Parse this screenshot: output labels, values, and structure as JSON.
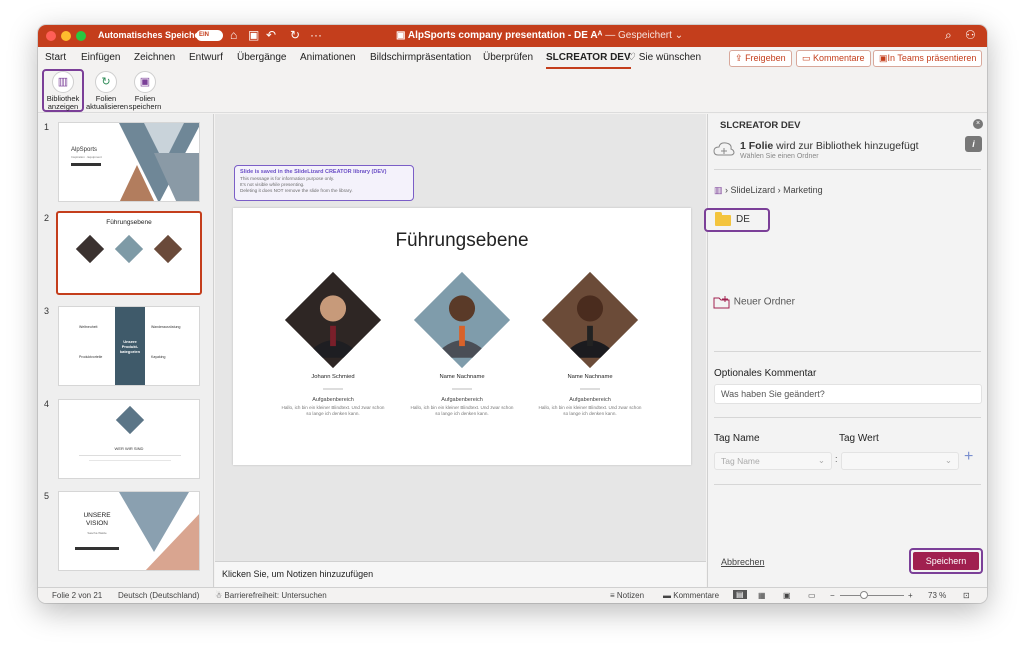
{
  "window": {
    "autosave_label": "Automatisches Speichern",
    "autosave_state": "EIN",
    "doc_title": "AlpSports company presentation - DE",
    "doc_status": "— Gespeichert",
    "colors": {
      "accent": "#c43e1c",
      "selection": "#7b3f98",
      "save": "#a0204f"
    }
  },
  "tabs": [
    "Start",
    "Einfügen",
    "Zeichnen",
    "Entwurf",
    "Übergänge",
    "Animationen",
    "Bildschirmpräsentation",
    "Überprüfen",
    "SLCREATOR DEV",
    "Sie wünschen"
  ],
  "share_buttons": {
    "share": "Freigeben",
    "comments": "Kommentare",
    "teams": "In Teams präsentieren"
  },
  "ribbon": {
    "library": "Bibliothek anzeigen",
    "refresh": "Folien aktualisieren",
    "save": "Folien speichern"
  },
  "thumbnails": [
    {
      "num": "1",
      "title": "AlpSports",
      "subtitle": "Inspiration · Equipment"
    },
    {
      "num": "2",
      "title": "Führungsebene"
    },
    {
      "num": "3",
      "left_top": "Weltneuheit",
      "left_bottom": "Produktvorteile",
      "center": "Unsere Produkt-kategorien",
      "right_top": "Wanderausrüstung",
      "right_bottom": "Kayaking"
    },
    {
      "num": "4",
      "title": "WER WIR SIND"
    },
    {
      "num": "5",
      "title": "UNSERE VISION",
      "subtitle": "Sascha Walde"
    }
  ],
  "notice": {
    "title": "Slide is saved in the SlideLizard CREATOR library (DEV)",
    "line1": "This message is for information purpose only.",
    "line2": "It's not visible while presenting.",
    "line3": "Deleting it does NOT remove the slide from the library."
  },
  "slide": {
    "title": "Führungsebene",
    "people": [
      {
        "name": "Johann Schmied",
        "role": "Aufgabenbereich",
        "desc": "Hallo, ich bin ein kleiner Blindtext. Und zwar schon so lange ich denken kann."
      },
      {
        "name": "Name Nachname",
        "role": "Aufgabenbereich",
        "desc": "Hallo, ich bin ein kleiner Blindtext. Und zwar schon so lange ich denken kann."
      },
      {
        "name": "Name Nachname",
        "role": "Aufgabenbereich",
        "desc": "Hallo, ich bin ein kleiner Blindtext. Und zwar schon so lange ich denken kann."
      }
    ]
  },
  "notes_placeholder": "Klicken Sie, um Notizen hinzuzufügen",
  "pane": {
    "title": "SLCREATOR DEV",
    "count": "1 Folie",
    "headline_rest": " wird zur Bibliothek hinzugefügt",
    "subline": "Wählen Sie einen Ordner",
    "crumb_root": "SlideLizard",
    "crumb_current": "Marketing",
    "folder": "DE",
    "new_folder": "Neuer Ordner",
    "comment_label": "Optionales Kommentar",
    "comment_placeholder": "Was haben Sie geändert?",
    "tag_name_label": "Tag Name",
    "tag_value_label": "Tag Wert",
    "tag_name_placeholder": "Tag Name",
    "cancel": "Abbrechen",
    "save": "Speichern"
  },
  "status": {
    "slide_pos": "Folie 2 von 21",
    "language": "Deutsch (Deutschland)",
    "accessibility": "Barrierefreiheit: Untersuchen",
    "notes": "Notizen",
    "comments": "Kommentare",
    "zoom": "73 %"
  }
}
